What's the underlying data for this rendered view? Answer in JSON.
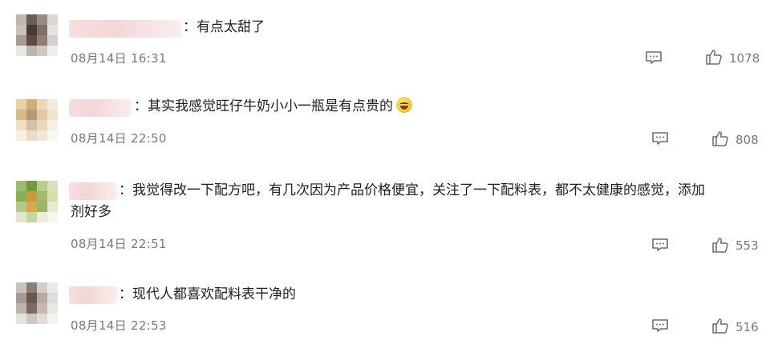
{
  "comments": [
    {
      "text": "：有点太甜了",
      "time": "08月14日 16:31",
      "likes": "1078",
      "avatar_colors": [
        "#bfb7b0",
        "#6e5d57",
        "#9a8a84",
        "#d9d6d3",
        "#c9c1bb",
        "#4b3a34",
        "#7f6e68",
        "#e5e3e1",
        "#a89c96",
        "#5e4a43",
        "#8f7d77",
        "#d4cfcb",
        "#e9e7e6",
        "#bdb4ae",
        "#cfc8c3",
        "#f0efee"
      ]
    },
    {
      "text": "：其实我感觉旺仔牛奶小小一瓶是有点贵的",
      "time": "08月14日 22:50",
      "likes": "808",
      "avatar_colors": [
        "#e6d3a8",
        "#cdb077",
        "#e9d9b8",
        "#f4eadc",
        "#d7b98b",
        "#b89a72",
        "#e2c9a3",
        "#efe2cf",
        "#f0dfc4",
        "#d5c0a5",
        "#ead6b8",
        "#f6efe5",
        "#f7efe3",
        "#ecdcc5",
        "#f2e6d6",
        "#faf6f0"
      ]
    },
    {
      "text_line1": "：我觉得改一下配方吧，有几次因为产品价格便宜，关注了一下配料表，都不太健康的感觉，添加",
      "text_line2": "剂好多",
      "time": "08月14日 22:51",
      "likes": "553",
      "avatar_colors": [
        "#9dbb6a",
        "#6f9a3d",
        "#b7cf86",
        "#d6e2b9",
        "#8aae55",
        "#c79a3d",
        "#a3b96c",
        "#cfe0a9",
        "#b6c98a",
        "#d9a94a",
        "#9cb567",
        "#e4ebcf",
        "#dfe7c8",
        "#c6d6a2",
        "#e8eed8",
        "#f3f6ec"
      ]
    },
    {
      "text": "：现代人都喜欢配料表干净的",
      "time": "08月14日 22:53",
      "likes": "516",
      "avatar_colors": [
        "#c9c3bf",
        "#8b7d76",
        "#d3cdca",
        "#ece9e7",
        "#a99b94",
        "#6a5850",
        "#b6aaa3",
        "#e1dcd9",
        "#bfb4ae",
        "#7d6b63",
        "#c4b9b3",
        "#eae6e4",
        "#e6e2e0",
        "#cfc7c2",
        "#e0dbd8",
        "#f4f2f1"
      ]
    }
  ],
  "icons": {
    "reply": "comment-reply-icon",
    "like": "thumbs-up-icon"
  },
  "colors": {
    "text": "#1f1f1f",
    "meta": "#7a7a7a",
    "username_blur": "#f4d6d6"
  }
}
